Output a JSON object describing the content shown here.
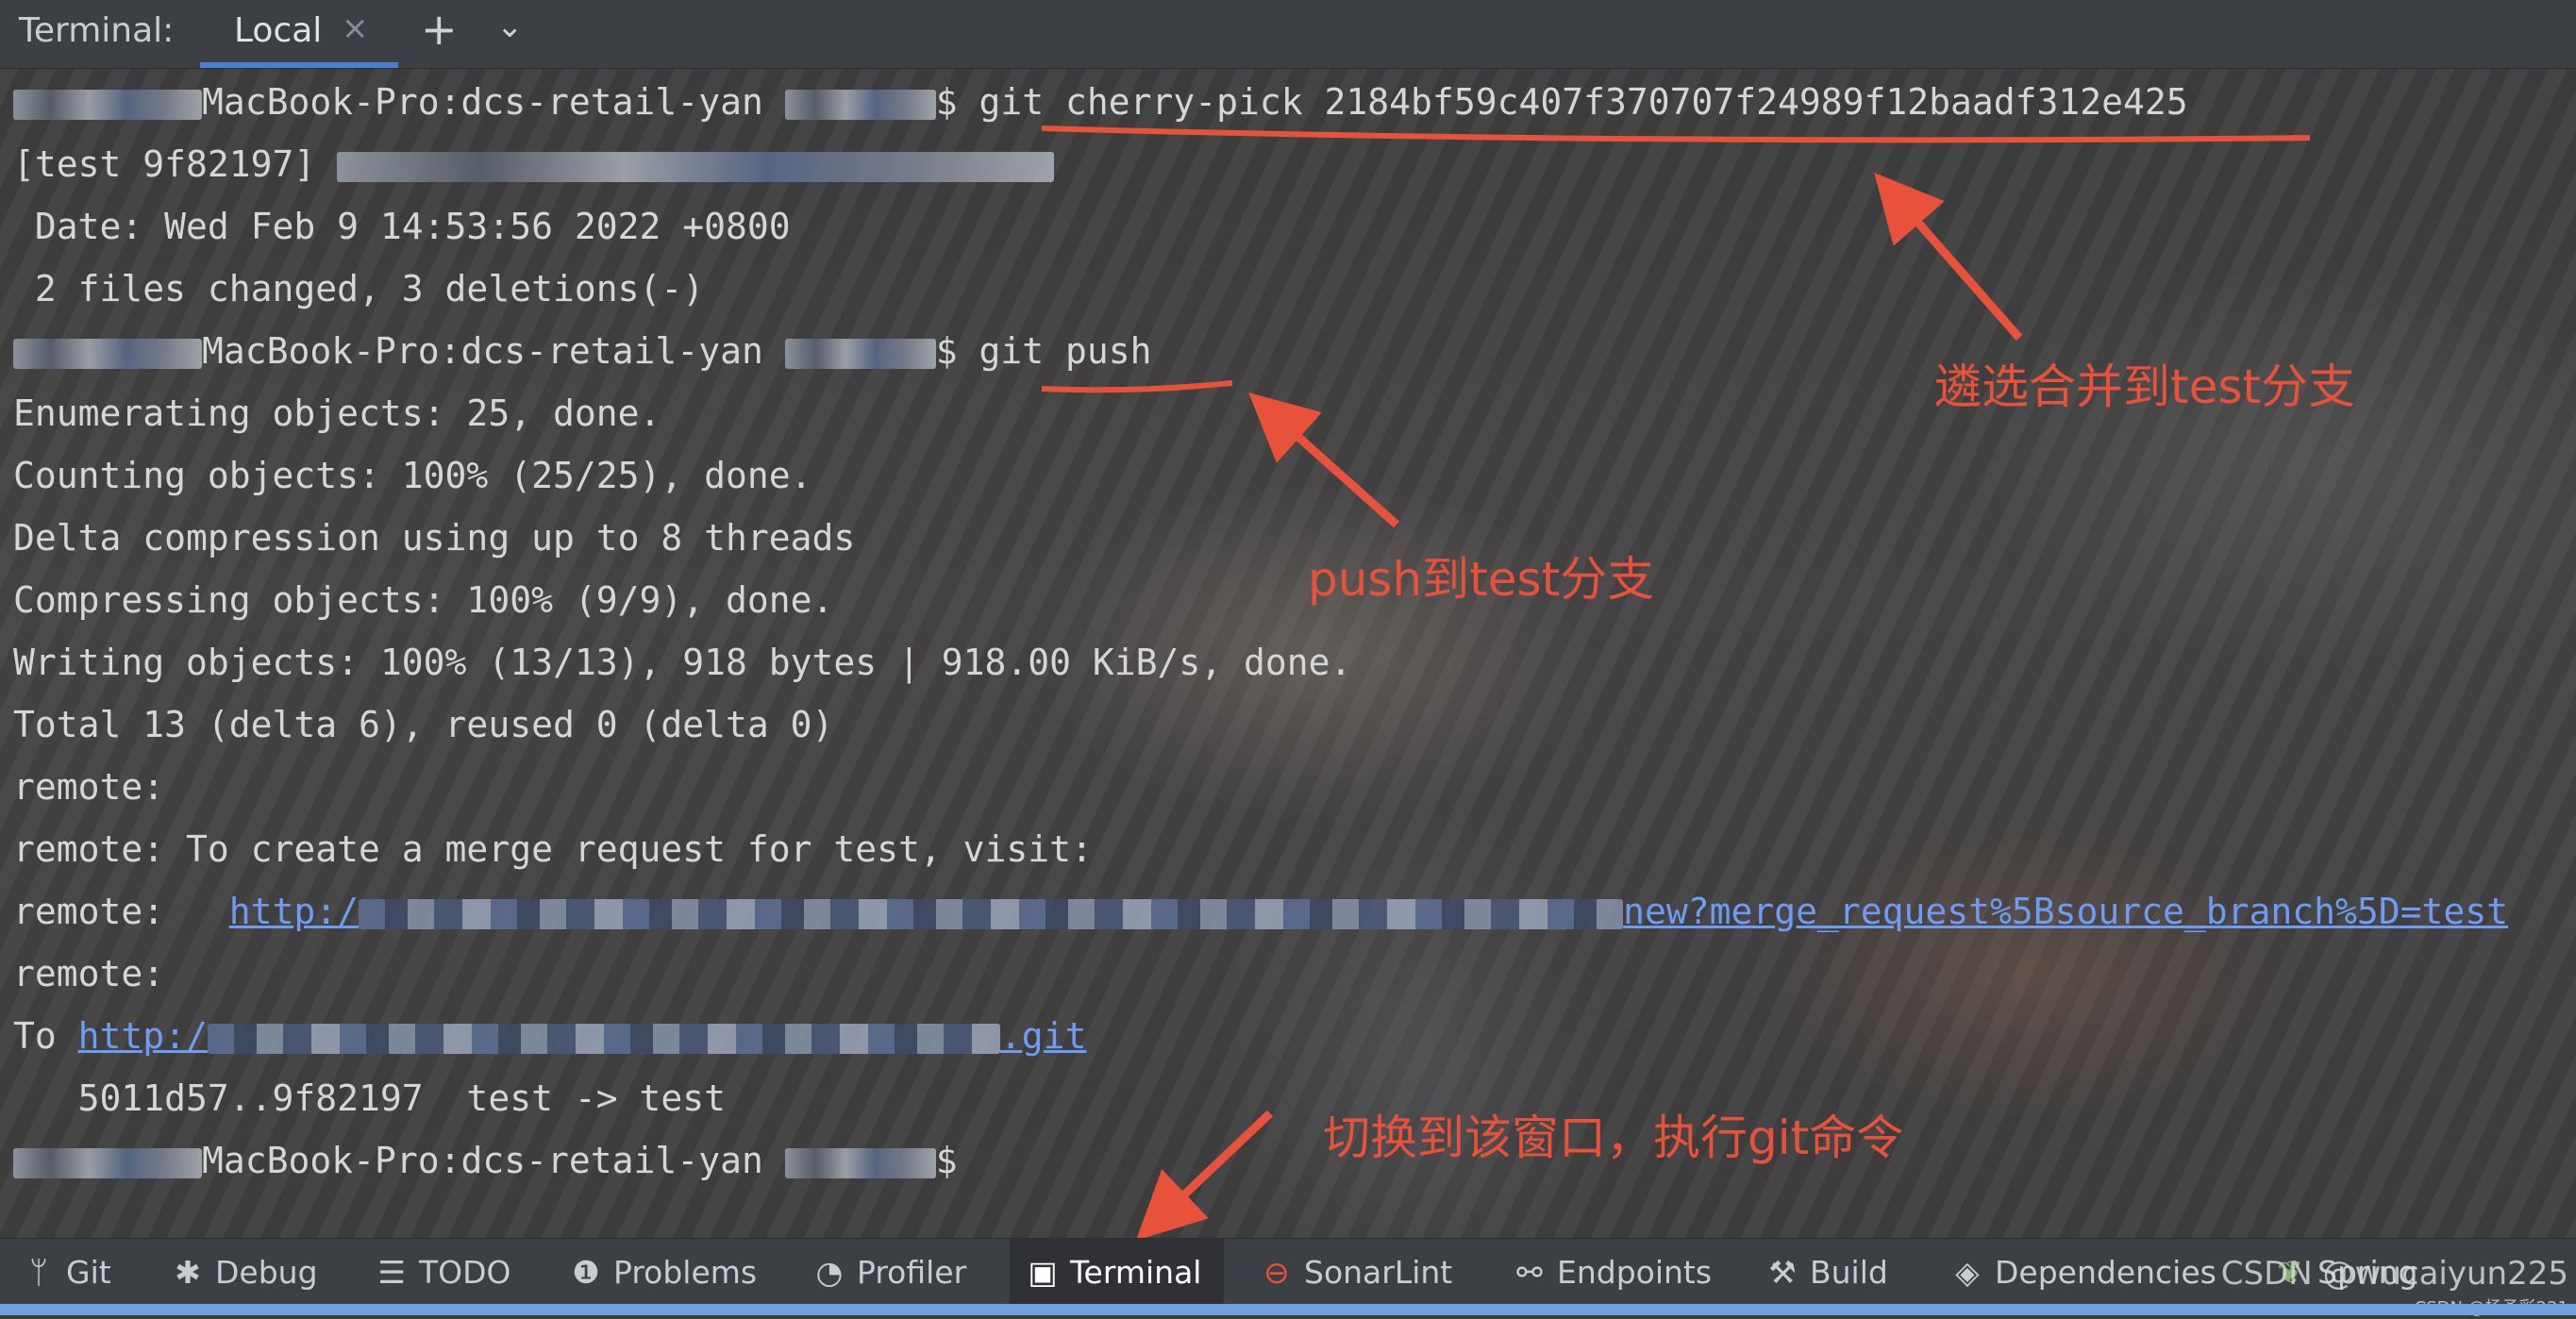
{
  "topbar": {
    "title": "Terminal:",
    "tab_local": "Local",
    "tab_close": "×",
    "new_tab": "+",
    "dropdown": "⌄"
  },
  "terminal": {
    "prompt_host": "MacBook-Pro:dcs-retail-yan",
    "prompt_end": "$",
    "line1_cmd": "git cherry-pick 2184bf59c407f370707f24989f12baadf312e425",
    "line2_prefix": "[test 9f82197]",
    "line3": " Date: Wed Feb 9 14:53:56 2022 +0800",
    "line4": " 2 files changed, 3 deletions(-)",
    "line5_cmd": "git push",
    "line6": "Enumerating objects: 25, done.",
    "line7": "Counting objects: 100% (25/25), done.",
    "line8": "Delta compression using up to 8 threads",
    "line9": "Compressing objects: 100% (9/9), done.",
    "line10": "Writing objects: 100% (13/13), 918 bytes | 918.00 KiB/s, done.",
    "line11": "Total 13 (delta 6), reused 0 (delta 0)",
    "line12": "remote:",
    "line13": "remote: To create a merge request for test, visit:",
    "line14_prefix": "remote:   ",
    "line14_link_start": "http:/",
    "line14_link_end": "new?merge_request%5Bsource_branch%5D=test",
    "line15": "remote:",
    "line16_prefix": "To ",
    "line16_link_start": "http:/",
    "line16_link_end": ".git",
    "line17": "   5011d57..9f82197  test -> test"
  },
  "annotations": {
    "cherry_pick": "遴选合并到test分支",
    "push": "push到test分支",
    "switch": "切换到该窗口，执行git命令"
  },
  "toolbar": {
    "git": "Git",
    "debug": "Debug",
    "todo": "TODO",
    "problems": "Problems",
    "profiler": "Profiler",
    "terminal": "Terminal",
    "sonarlint": "SonarLint",
    "endpoints": "Endpoints",
    "build": "Build",
    "dependencies": "Dependencies",
    "spring": "Spring"
  },
  "watermark": "CSDN @wucaiyun225",
  "watermark_small": "CSDN @杨予彩221",
  "colors": {
    "annotation": "#e8513a",
    "link": "#6d9cf2",
    "accent": "#4b7fd1"
  }
}
